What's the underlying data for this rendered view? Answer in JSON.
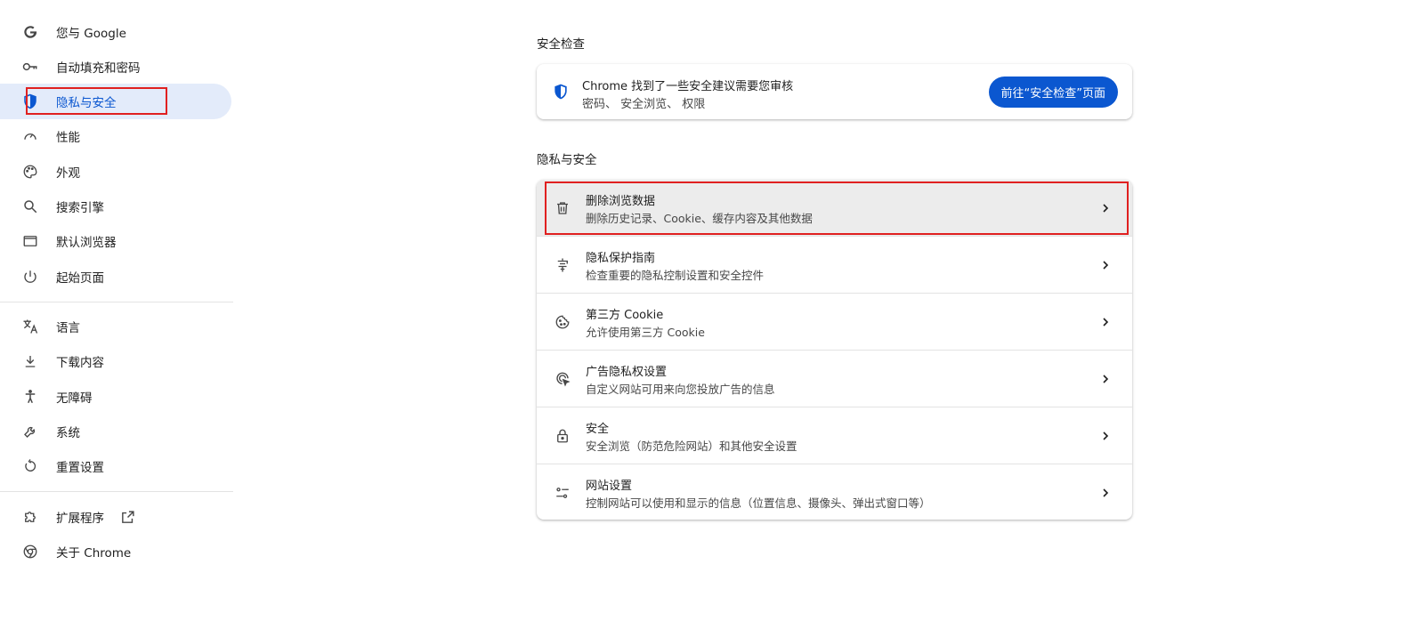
{
  "sidebar": {
    "items": [
      {
        "label": "您与 Google",
        "icon": "google-g-icon"
      },
      {
        "label": "自动填充和密码",
        "icon": "key-icon"
      },
      {
        "label": "隐私与安全",
        "icon": "shield-icon",
        "active": true
      },
      {
        "label": "性能",
        "icon": "speedometer-icon"
      },
      {
        "label": "外观",
        "icon": "palette-icon"
      },
      {
        "label": "搜索引擎",
        "icon": "search-icon"
      },
      {
        "label": "默认浏览器",
        "icon": "browser-window-icon"
      },
      {
        "label": "起始页面",
        "icon": "power-icon"
      },
      {
        "label": "语言",
        "icon": "translate-icon"
      },
      {
        "label": "下载内容",
        "icon": "download-icon"
      },
      {
        "label": "无障碍",
        "icon": "accessibility-icon"
      },
      {
        "label": "系统",
        "icon": "wrench-icon"
      },
      {
        "label": "重置设置",
        "icon": "reset-icon"
      },
      {
        "label": "扩展程序",
        "icon": "puzzle-icon",
        "external_icon": "open-in-new-icon"
      },
      {
        "label": "关于 Chrome",
        "icon": "chrome-icon"
      }
    ]
  },
  "safety_check": {
    "section_title": "安全检查",
    "title": "Chrome 找到了一些安全建议需要您审核",
    "subtitle": "密码、 安全浏览、 权限",
    "button_label": "前往“安全检查”页面",
    "icon": "shield-check-icon"
  },
  "privacy": {
    "section_title": "隐私与安全",
    "rows": [
      {
        "title": "删除浏览数据",
        "subtitle": "删除历史记录、Cookie、缓存内容及其他数据",
        "icon": "trash-icon"
      },
      {
        "title": "隐私保护指南",
        "subtitle": "检查重要的隐私控制设置和安全控件",
        "icon": "privacy-guide-icon"
      },
      {
        "title": "第三方 Cookie",
        "subtitle": "允许使用第三方 Cookie",
        "icon": "cookie-icon"
      },
      {
        "title": "广告隐私权设置",
        "subtitle": "自定义网站可用来向您投放广告的信息",
        "icon": "ad-privacy-icon"
      },
      {
        "title": "安全",
        "subtitle": "安全浏览（防范危险网站）和其他安全设置",
        "icon": "lock-icon"
      },
      {
        "title": "网站设置",
        "subtitle": "控制网站可以使用和显示的信息（位置信息、摄像头、弹出式窗口等）",
        "icon": "site-settings-icon"
      }
    ]
  },
  "colors": {
    "accent": "#0b57d0",
    "active_bg": "#e3ebfa",
    "highlight": "#e02020"
  }
}
